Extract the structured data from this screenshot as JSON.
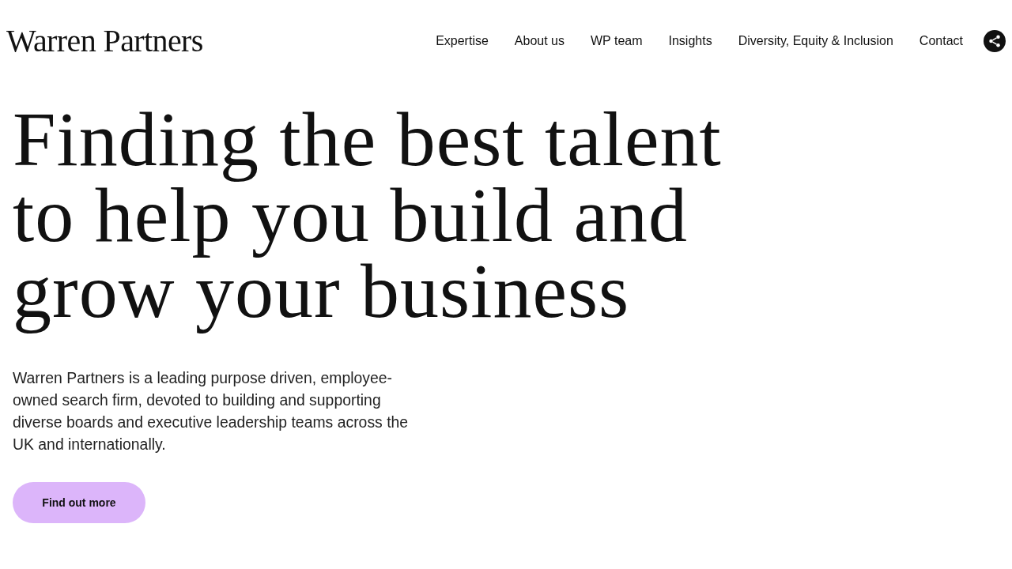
{
  "header": {
    "logo": "Warren Partners",
    "nav": [
      {
        "label": "Expertise"
      },
      {
        "label": "About us"
      },
      {
        "label": "WP team"
      },
      {
        "label": "Insights"
      },
      {
        "label": "Diversity, Equity & Inclusion"
      },
      {
        "label": "Contact"
      }
    ]
  },
  "hero": {
    "headline": [
      "Finding the best talent",
      "to help you build and",
      "grow your business"
    ],
    "intro": "Warren Partners is a leading purpose driven, employee-owned search firm, devoted to building and supporting diverse boards and executive leadership teams across the UK and internationally.",
    "button": "Find out more"
  }
}
